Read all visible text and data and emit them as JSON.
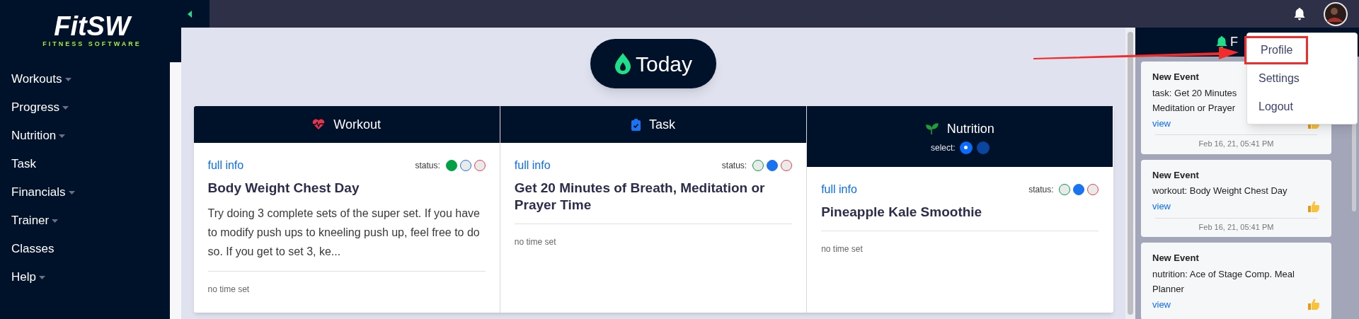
{
  "logo": {
    "title": "FitSW",
    "subtitle": "FITNESS SOFTWARE"
  },
  "sidebar": {
    "items": [
      {
        "label": "Workouts",
        "has_menu": true
      },
      {
        "label": "Progress",
        "has_menu": true
      },
      {
        "label": "Nutrition",
        "has_menu": true
      },
      {
        "label": "Task",
        "has_menu": false
      },
      {
        "label": "Financials",
        "has_menu": true
      },
      {
        "label": "Trainer",
        "has_menu": true
      },
      {
        "label": "Classes",
        "has_menu": false
      },
      {
        "label": "Help",
        "has_menu": true
      }
    ]
  },
  "today_button": {
    "label": "Today"
  },
  "cards": [
    {
      "kind": "workout",
      "title": "Workout",
      "link": "full info",
      "status_label": "status:",
      "statuses": [
        {
          "color": "#00a046",
          "selected": true
        },
        {
          "color": "#1a73f0",
          "selected": false
        },
        {
          "color": "#e8404f",
          "selected": false
        }
      ],
      "name": "Body Weight Chest Day",
      "description": "Try doing 3 complete sets of the super set. If you have to modify push ups to kneeling push up, feel free to do so. If you get to set 3, ke...",
      "time": "no time set"
    },
    {
      "kind": "task",
      "title": "Task",
      "link": "full info",
      "status_label": "status:",
      "statuses": [
        {
          "color": "#00a046",
          "selected": false
        },
        {
          "color": "#1a73f0",
          "selected": true
        },
        {
          "color": "#e8404f",
          "selected": false
        }
      ],
      "name": "Get 20 Minutes of Breath, Meditation or Prayer Time",
      "time": "no time set"
    },
    {
      "kind": "nutrition",
      "title": "Nutrition",
      "select_label": "select:",
      "select_options": [
        {
          "selected": true
        },
        {
          "selected": false
        }
      ],
      "link": "full info",
      "status_label": "status:",
      "statuses": [
        {
          "color": "#00a046",
          "selected": false
        },
        {
          "color": "#1a73f0",
          "selected": true
        },
        {
          "color": "#e8404f",
          "selected": false
        }
      ],
      "name": "Pineapple Kale Smoothie",
      "time": "no time set"
    }
  ],
  "feed": {
    "title": "F",
    "items": [
      {
        "title": "New Event",
        "lines": [
          "task: Get 20 Minutes",
          "Meditation or Prayer"
        ],
        "link": "view",
        "date": "Feb 16, 21, 05:41 PM"
      },
      {
        "title": "New Event",
        "lines": [
          "workout: Body Weight Chest Day"
        ],
        "link": "view",
        "date": "Feb 16, 21, 05:41 PM"
      },
      {
        "title": "New Event",
        "lines": [
          "nutrition: Ace of Stage Comp. Meal",
          "Planner"
        ],
        "link": "view"
      }
    ]
  },
  "user_menu": {
    "items": [
      {
        "label": "Profile",
        "highlighted": true
      },
      {
        "label": "Settings",
        "highlighted": false
      },
      {
        "label": "Logout",
        "highlighted": false
      }
    ]
  }
}
